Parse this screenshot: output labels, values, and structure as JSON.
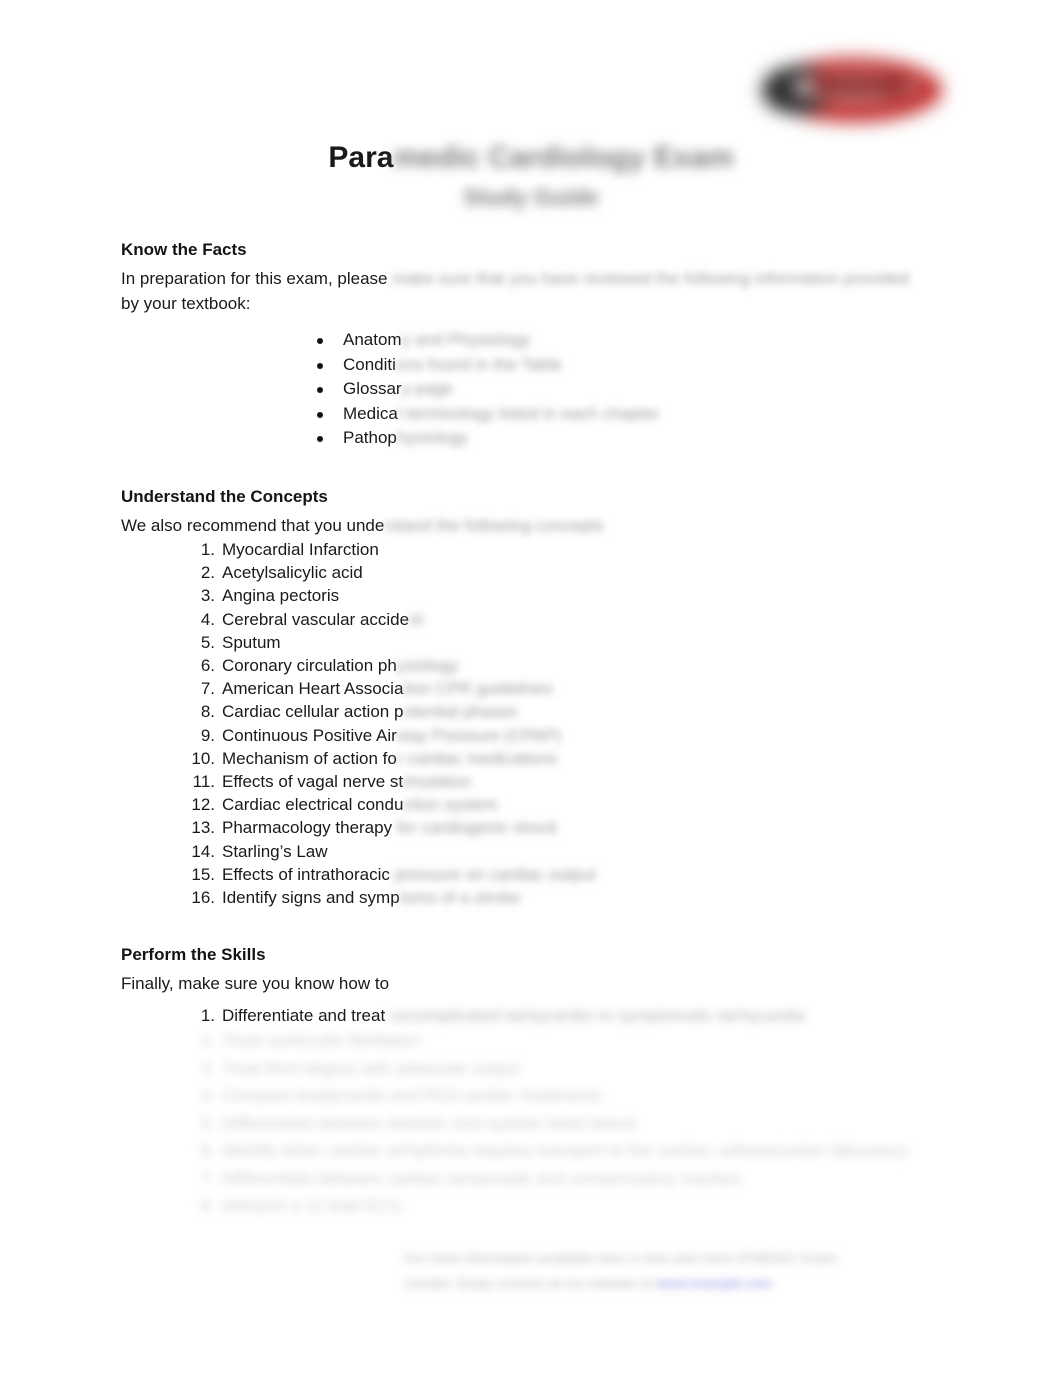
{
  "document": {
    "title_visible": "Para",
    "title_obscured": "medic Cardiology Exam",
    "subtitle_obscured": "Study Guide"
  },
  "logo": {
    "name": "company-logo",
    "colors": {
      "red": "#c22b2b",
      "dark": "#2b2b2b",
      "inner": "#d9cfd0"
    }
  },
  "sections": {
    "know_the_facts": {
      "heading": "Know the Facts",
      "intro_visible": "In preparation for this exam, please ",
      "intro_obscured": "make sure that you have reviewed the following information provided",
      "intro_line2": "by your textbook:",
      "bullets": [
        {
          "visible": "Anatom",
          "obscured": "y and Physiology"
        },
        {
          "visible": "Conditi",
          "obscured": "ons found in the Table"
        },
        {
          "visible": "Glossar",
          "obscured": "y page"
        },
        {
          "visible": "Medica",
          "obscured": "l terminology listed in each chapter"
        },
        {
          "visible": "Pathop",
          "obscured": "hysiology"
        }
      ]
    },
    "understand_the_concepts": {
      "heading": "Understand the Concepts",
      "intro_visible": "We also recommend that you unde",
      "intro_obscured": "rstand the following concepts",
      "items": [
        {
          "number": "1.",
          "visible": "Myocardial Infarction",
          "obscured": ""
        },
        {
          "number": "2.",
          "visible": "Acetylsalicylic acid",
          "obscured": ""
        },
        {
          "number": "3.",
          "visible": "Angina pectoris",
          "obscured": ""
        },
        {
          "number": "4.",
          "visible": "Cerebral vascular accide",
          "obscured": "nt"
        },
        {
          "number": "5.",
          "visible": "Sputum",
          "obscured": ""
        },
        {
          "number": "6.",
          "visible": "Coronary circulation ph",
          "obscured": "ysiology"
        },
        {
          "number": "7.",
          "visible": "American Heart Associa",
          "obscured": "tion CPR guidelines"
        },
        {
          "number": "8.",
          "visible": "Cardiac cellular action p",
          "obscured": "otential phases"
        },
        {
          "number": "9.",
          "visible": "Continuous Positive Air",
          "obscured": "way Pressure (CPAP)"
        },
        {
          "number": "10.",
          "visible": "Mechanism of action fo",
          "obscured": "r cardiac medications"
        },
        {
          "number": "11.",
          "visible": "Effects of vagal nerve st",
          "obscured": "imulation"
        },
        {
          "number": "12.",
          "visible": "Cardiac electrical condu",
          "obscured": "ction system"
        },
        {
          "number": "13.",
          "visible": "Pharmacology therapy",
          "obscured": " for cardiogenic shock"
        },
        {
          "number": "14.",
          "visible": "Starling’s Law",
          "obscured": ""
        },
        {
          "number": "15.",
          "visible": "Effects of intrathoracic",
          "obscured": " pressure on cardiac output"
        },
        {
          "number": "16.",
          "visible": "Identify signs and symp",
          "obscured": "toms of a stroke"
        }
      ]
    },
    "perform_the_skills": {
      "heading": "Perform the Skills",
      "intro": "Finally, make sure you know how to",
      "items": [
        {
          "number": "1.",
          "visible": "Differentiate and treat ",
          "obscured": "uncomplicated tachycardia vs symptomatic tachycardia"
        },
        {
          "number": "2.",
          "visible": "",
          "obscured": "Treat ventricular fibrillation"
        },
        {
          "number": "3.",
          "visible": "",
          "obscured": "Treat third degree with adequate output"
        },
        {
          "number": "4.",
          "visible": "",
          "obscured": "Compare bradycardia and PEA cardiac treatments"
        },
        {
          "number": "5.",
          "visible": "",
          "obscured": "Differentiate between diastolic and systolic heart failure"
        },
        {
          "number": "6.",
          "visible": "",
          "obscured": "Identify when cardiac arrhythmia requires transport to the cardiac catheterization laboratory"
        },
        {
          "number": "7.",
          "visible": "",
          "obscured": "Differentiate between cardiac tamponade and compensatory reaction"
        },
        {
          "number": "8.",
          "visible": "",
          "obscured": "Interpret a 12 lead ECG"
        }
      ]
    }
  },
  "footer": {
    "line1": "For more information available here or free and more ATMEDIC Exam",
    "line2_text": "Cardiac Study courses at our website at ",
    "line2_link": "www.example.com",
    "link_color": "#8c8ce2"
  }
}
